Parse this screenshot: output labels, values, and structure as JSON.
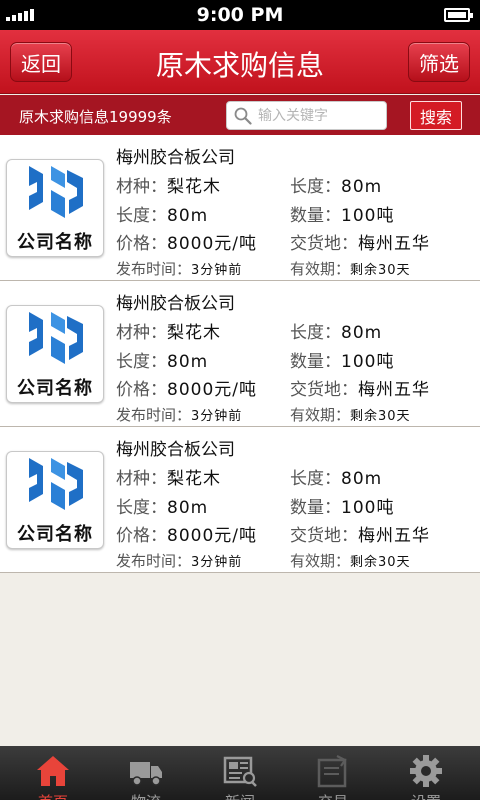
{
  "status": {
    "time": "9:00 PM"
  },
  "nav": {
    "back_label": "返回",
    "title": "原木求购信息",
    "filter_label": "筛选"
  },
  "search": {
    "count_text": "原木求购信息19999条",
    "placeholder": "输入关键字",
    "button_label": "搜索"
  },
  "listings": [
    {
      "logo_text": "公司名称",
      "company": "梅州胶合板公司",
      "species_label": "材种：",
      "species": "梨花木",
      "length_label_right": "长度：",
      "length_right": "80m",
      "length_label": "长度：",
      "length": "80m",
      "qty_label": "数量：",
      "qty": "100吨",
      "price_label": "价格：",
      "price": "8000元/吨",
      "delivery_label": "交货地：",
      "delivery": "梅州五华",
      "posted_label": "发布时间：",
      "posted": "3分钟前",
      "validity_label": "有效期：",
      "validity": "剩余30天"
    },
    {
      "logo_text": "公司名称",
      "company": "梅州胶合板公司",
      "species_label": "材种：",
      "species": "梨花木",
      "length_label_right": "长度：",
      "length_right": "80m",
      "length_label": "长度：",
      "length": "80m",
      "qty_label": "数量：",
      "qty": "100吨",
      "price_label": "价格：",
      "price": "8000元/吨",
      "delivery_label": "交货地：",
      "delivery": "梅州五华",
      "posted_label": "发布时间：",
      "posted": "3分钟前",
      "validity_label": "有效期：",
      "validity": "剩余30天"
    },
    {
      "logo_text": "公司名称",
      "company": "梅州胶合板公司",
      "species_label": "材种：",
      "species": "梨花木",
      "length_label_right": "长度：",
      "length_right": "80m",
      "length_label": "长度：",
      "length": "80m",
      "qty_label": "数量：",
      "qty": "100吨",
      "price_label": "价格：",
      "price": "8000元/吨",
      "delivery_label": "交货地：",
      "delivery": "梅州五华",
      "posted_label": "发布时间：",
      "posted": "3分钟前",
      "validity_label": "有效期：",
      "validity": "剩余30天"
    }
  ],
  "tabs": [
    {
      "label": "首页",
      "icon": "home-icon",
      "active": true
    },
    {
      "label": "物流",
      "icon": "truck-icon",
      "active": false
    },
    {
      "label": "新闻",
      "icon": "newspaper-icon",
      "active": false
    },
    {
      "label": "交易",
      "icon": "trade-icon",
      "active": false
    },
    {
      "label": "设置",
      "icon": "gear-icon",
      "active": false
    }
  ],
  "colors": {
    "brand_red": "#c1121d",
    "active_tab": "#e8443a"
  }
}
